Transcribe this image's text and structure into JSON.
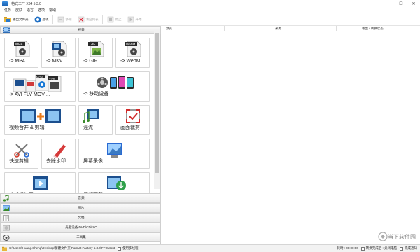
{
  "window": {
    "title": "格式工厂 X64 5.3.0"
  },
  "menu": [
    "任务",
    "皮肤",
    "语言",
    "选项",
    "帮助"
  ],
  "toolbar": {
    "output_folder": "输出文件夹",
    "options": "选项",
    "remove": "移除",
    "clear_list": "清空列表",
    "stop": "停止",
    "start": "开始"
  },
  "left": {
    "video_category": "视频",
    "tiles": [
      "-> MP4",
      "-> MKV",
      "-> GIF",
      "-> WebM",
      "-> AVI FLV MOV ...",
      "-> 移动设备",
      "视频合并 & 剪辑",
      "混流",
      "画面裁剪",
      "快速剪辑",
      "去除水印",
      "屏幕录像",
      "格式播放器",
      "视频下载"
    ],
    "icon_labels": {
      "mp4": "MP4",
      "gif": "GIF",
      "webm": "WebM",
      "mov": "MOV",
      "vob": "VOB"
    },
    "categories": [
      "音频",
      "图片",
      "文档",
      "光驱设备\\DVD\\CD\\ISO",
      "工具集"
    ]
  },
  "table": {
    "columns": [
      "预览",
      "来源",
      "输出 / 转换状态"
    ]
  },
  "status": {
    "path": "C:\\Users\\Huang.Sheng\\Desktop\\新建文件夹\\Format Factory 5.3.0\\FFOutput",
    "use_multithread": "使用多线程",
    "elapsed": "耗时 : 00:00:00",
    "shutdown": "转换完成后 : 关闭电脑",
    "notify": "完成通知"
  },
  "watermark": {
    "text": "当下软件园"
  },
  "colors": {
    "accent": "#1b6fc2",
    "tile_border": "#d7d7d7",
    "header_gradient": "#e9e9e9"
  }
}
